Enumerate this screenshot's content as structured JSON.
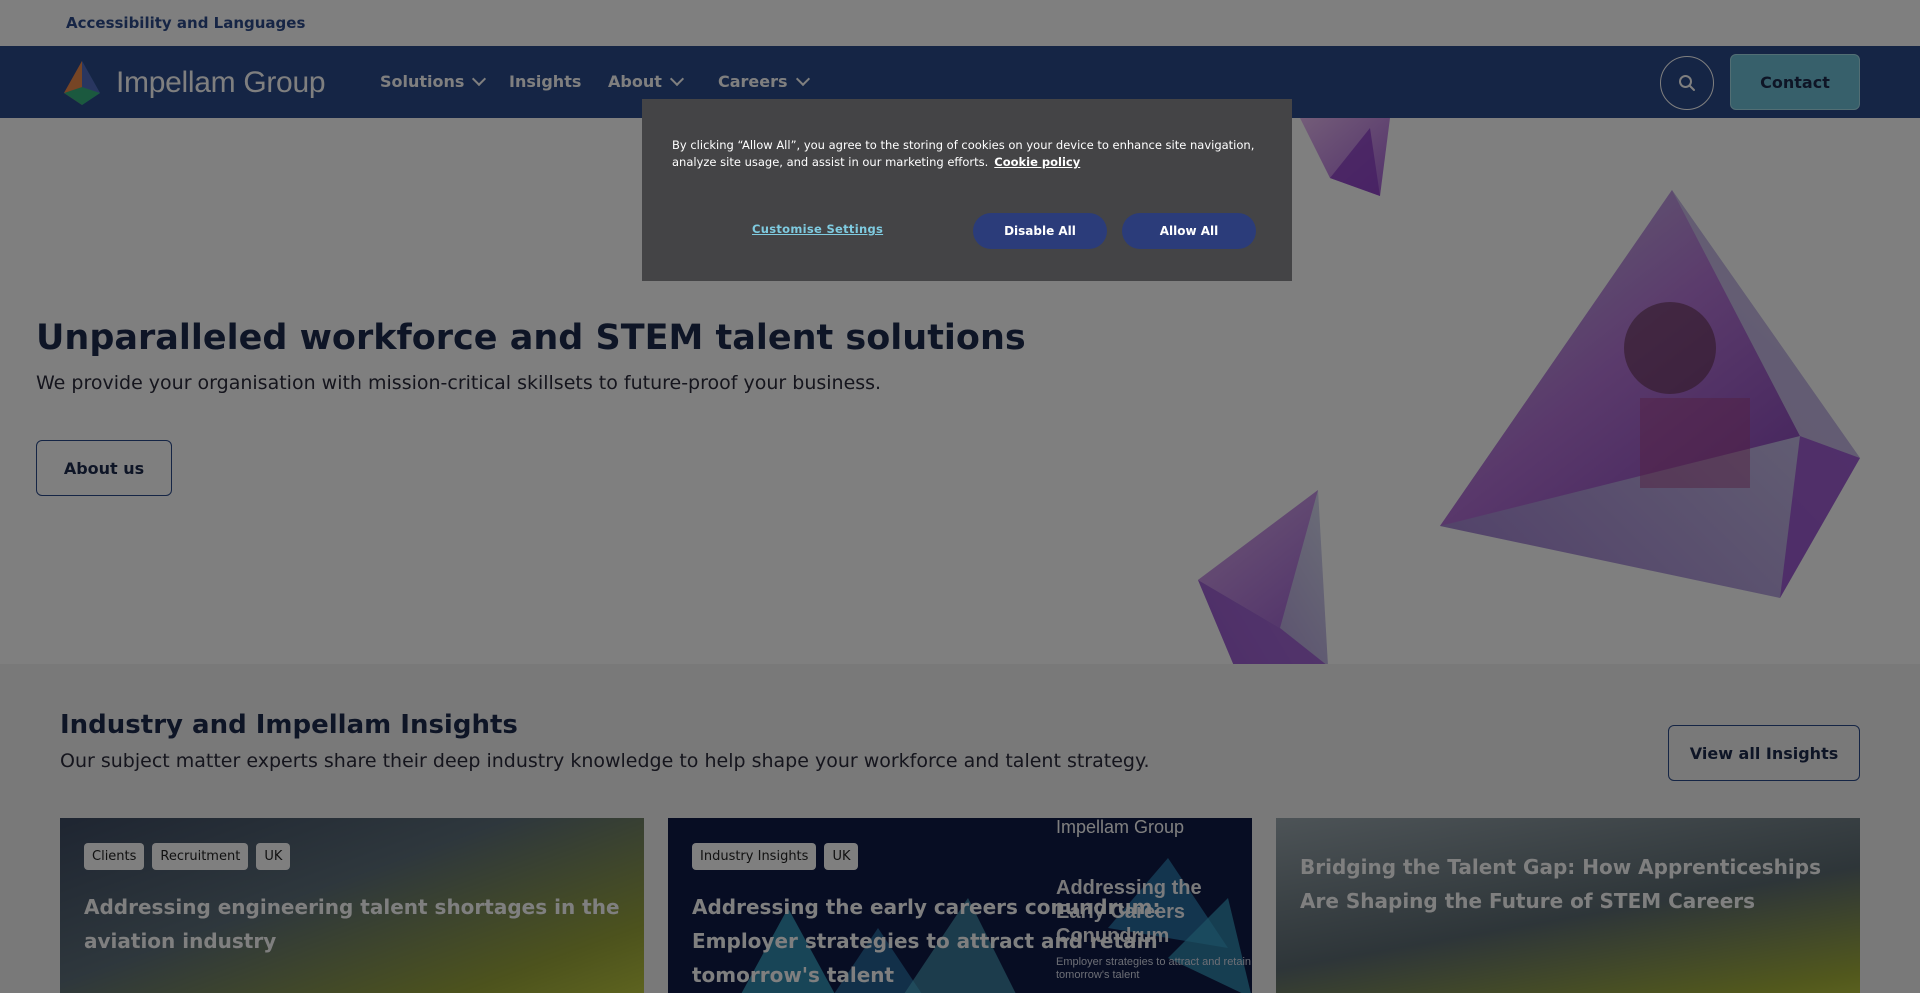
{
  "topbar": {
    "accessibility_label": "Accessibility and Languages"
  },
  "nav": {
    "logo_text": "Impellam Group",
    "items": [
      {
        "label": "Solutions",
        "has_dropdown": true
      },
      {
        "label": "Insights",
        "has_dropdown": false
      },
      {
        "label": "About",
        "has_dropdown": true
      },
      {
        "label": "Careers",
        "has_dropdown": true
      }
    ],
    "search_icon": "search-icon",
    "contact_label": "Contact"
  },
  "hero": {
    "title": "Unparalleled workforce and STEM talent solutions",
    "subtitle": "We provide your organisation with mission-critical skillsets to future-proof your business.",
    "button_label": "About us"
  },
  "insights": {
    "title": "Industry and Impellam Insights",
    "subtitle": "Our subject matter experts share their deep industry knowledge to help shape your workforce and talent strategy.",
    "view_all_label": "View all Insights",
    "cards": [
      {
        "tags": [
          "Clients",
          "Recruitment",
          "UK"
        ],
        "title": "Addressing engineering talent shortages in the aviation industry"
      },
      {
        "tags": [
          "Industry Insights",
          "UK"
        ],
        "title": "Addressing the early careers conundrum: Employer strategies to attract and retain tomorrow's talent",
        "image_logo": "Impellam Group",
        "image_heading": "Addressing the Early Careers Conundrum",
        "image_subtext": "Employer strategies to attract and retain tomorrow's talent"
      },
      {
        "tags": [],
        "title": "Bridging the Talent Gap: How Apprenticeships Are Shaping the Future of STEM Careers"
      }
    ]
  },
  "cookie": {
    "message": "By clicking “Allow All”, you agree to the storing of cookies on your device to enhance site navigation, analyze site usage, and assist in our marketing efforts.",
    "policy_link": "Cookie policy",
    "customise_label": "Customise Settings",
    "disable_label": "Disable All",
    "allow_label": "Allow All"
  },
  "colors": {
    "nav_bg": "#2b4a8a",
    "contact_bg": "#6fc1d6",
    "heading": "#1d2a4d",
    "cookie_bg": "#444446",
    "cookie_button": "#2b3c7a",
    "cookie_link": "#7fcbe0"
  }
}
